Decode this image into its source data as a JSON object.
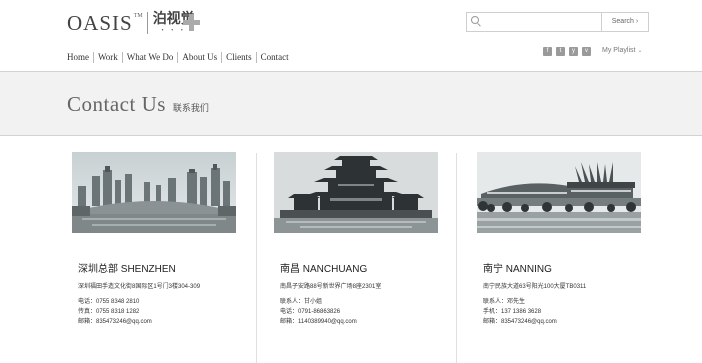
{
  "brand": {
    "name_en": "OASIS",
    "tm": "TM",
    "name_cn": "泊视觉",
    "dots": "• • •"
  },
  "search": {
    "placeholder": "",
    "button_label": "Search",
    "button_chevron": "›"
  },
  "nav": {
    "items": [
      "Home",
      "Work",
      "What We Do",
      "About Us",
      "Clients",
      "Contact"
    ]
  },
  "social": {
    "icons": [
      "f",
      "t",
      "y",
      "v"
    ],
    "playlist_label": "My Playlist",
    "playlist_chevron": "⌄"
  },
  "page": {
    "title_en": "Contact Us",
    "title_cn": "联系我们"
  },
  "offices": [
    {
      "name": "深圳总部 SHENZHEN",
      "address": "深圳福田手造文化街8国际区1号门3楼304-309",
      "lines": [
        "电话：0755 8348 2810",
        "传真：0755 8318 1282",
        "邮箱：835473246@qq.com"
      ]
    },
    {
      "name": "南昌 NANCHUANG",
      "address": "南昌子安路88号新世界广场8座2301室",
      "lines": [
        "联系人：甘小姐",
        "电话：0791-86863826",
        "邮箱：1140389940@qq.com"
      ]
    },
    {
      "name": "南宁 NANNING",
      "address": "南宁民族大道63号阳光100大厦TB0311",
      "lines": [
        "联系人：邓先生",
        "手机：137 1386 3628",
        "邮箱：835473246@qq.com"
      ]
    }
  ]
}
